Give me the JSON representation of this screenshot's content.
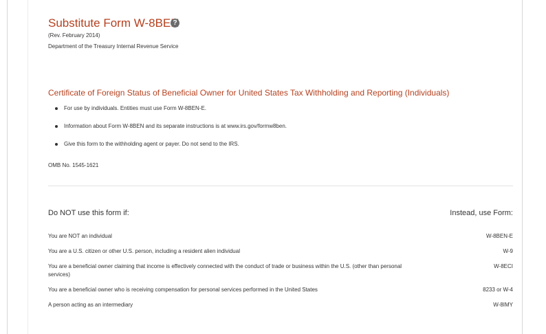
{
  "header": {
    "title": "Substitute Form W-8BEN",
    "help_icon": "question-circle-icon",
    "revision": "(Rev. February 2014)",
    "department": "Department of the Treasury Internal Revenue Service"
  },
  "certificate": {
    "title": "Certificate of Foreign Status of Beneficial Owner for United States Tax Withholding and Reporting (Individuals)",
    "bullets": [
      "For use by individuals. Entities must use Form W-8BEN-E.",
      "Information about Form W-8BEN and its separate instructions is at www.irs.gov/formw8ben.",
      "Give this form to the withholding agent or payer. Do not send to the IRS."
    ],
    "omb": "OMB No. 1545-1621"
  },
  "usage_table": {
    "left_heading": "Do NOT use this form if:",
    "right_heading": "Instead, use Form:",
    "rows": [
      {
        "condition": "You are NOT an individual",
        "form": "W-8BEN-E"
      },
      {
        "condition": "You are a U.S. citizen or other U.S. person, including a resident alien individual",
        "form": "W-9"
      },
      {
        "condition": "You are a beneficial owner claiming that income is effectively connected with the conduct of trade or business within the U.S. (other than personal services)",
        "form": "W-8ECI"
      },
      {
        "condition": "You are a beneficial owner who is receiving compensation for personal services performed in the United States",
        "form": "8233 or W-4"
      },
      {
        "condition": "A person acting as an intermediary",
        "form": "W-8IMY"
      }
    ]
  },
  "colors": {
    "accent": "#b5411f",
    "text": "#333333",
    "divider": "#e3e3e3"
  }
}
